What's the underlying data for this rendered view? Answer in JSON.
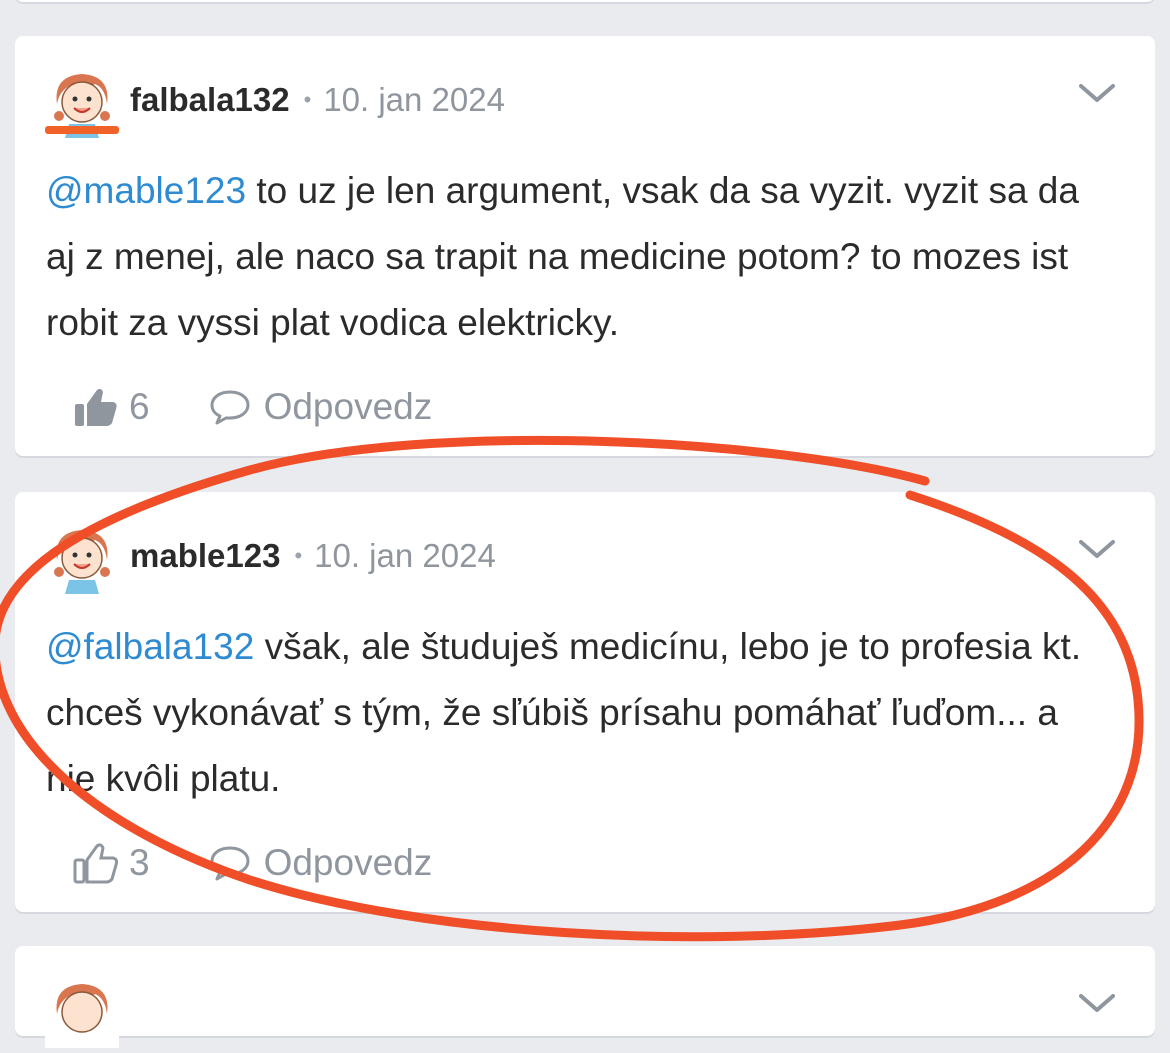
{
  "colors": {
    "mention": "#2f8bd1",
    "muted": "#8f969e",
    "annotation": "#f04e28",
    "background": "#e9ebef"
  },
  "comments": [
    {
      "username": "falbala132",
      "date": "10. jan 2024",
      "mention": "@mable123",
      "text": " to uz je len argument, vsak da sa vyzit. vyzit sa da aj z menej, ale naco sa trapit na medicine potom? to mozes ist robit za vyssi plat vodica elektricky.",
      "likes": "6",
      "reply_label": "Odpovedz"
    },
    {
      "username": "mable123",
      "date": "10. jan 2024",
      "mention": "@falbala132",
      "text": " však, ale študuješ medicínu, lebo je to profesia kt. chceš vykonávať s tým, že sľúbiš prísahu pomáhať ľuďom... a nie kvôli platu.",
      "likes": "3",
      "reply_label": "Odpovedz"
    }
  ],
  "icons": {
    "like": "thumbs-up-icon",
    "reply": "speech-bubble-icon",
    "menu": "chevron-down-icon",
    "avatar": "cartoon-girl-avatar"
  },
  "separator": "•"
}
